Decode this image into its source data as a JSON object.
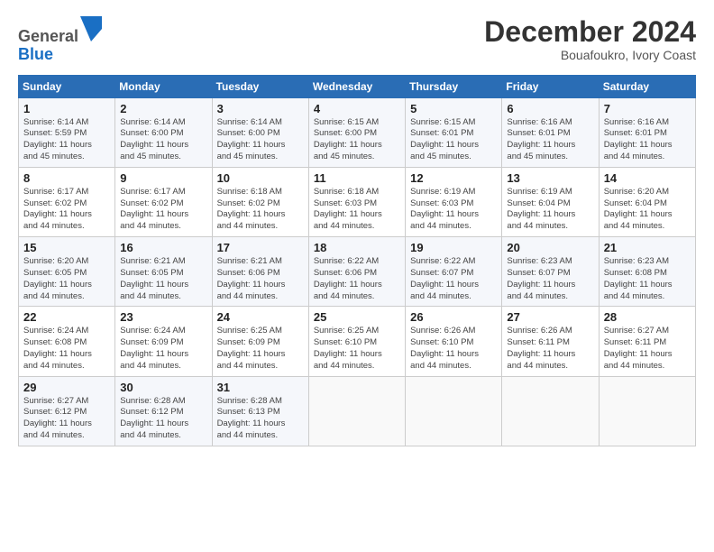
{
  "logo": {
    "general": "General",
    "blue": "Blue"
  },
  "calendar": {
    "title": "December 2024",
    "location": "Bouafoukro, Ivory Coast",
    "days": [
      "Sunday",
      "Monday",
      "Tuesday",
      "Wednesday",
      "Thursday",
      "Friday",
      "Saturday"
    ],
    "weeks": [
      [
        {
          "day": "1",
          "info": "Sunrise: 6:14 AM\nSunset: 5:59 PM\nDaylight: 11 hours\nand 45 minutes."
        },
        {
          "day": "2",
          "info": "Sunrise: 6:14 AM\nSunset: 6:00 PM\nDaylight: 11 hours\nand 45 minutes."
        },
        {
          "day": "3",
          "info": "Sunrise: 6:14 AM\nSunset: 6:00 PM\nDaylight: 11 hours\nand 45 minutes."
        },
        {
          "day": "4",
          "info": "Sunrise: 6:15 AM\nSunset: 6:00 PM\nDaylight: 11 hours\nand 45 minutes."
        },
        {
          "day": "5",
          "info": "Sunrise: 6:15 AM\nSunset: 6:01 PM\nDaylight: 11 hours\nand 45 minutes."
        },
        {
          "day": "6",
          "info": "Sunrise: 6:16 AM\nSunset: 6:01 PM\nDaylight: 11 hours\nand 45 minutes."
        },
        {
          "day": "7",
          "info": "Sunrise: 6:16 AM\nSunset: 6:01 PM\nDaylight: 11 hours\nand 44 minutes."
        }
      ],
      [
        {
          "day": "8",
          "info": "Sunrise: 6:17 AM\nSunset: 6:02 PM\nDaylight: 11 hours\nand 44 minutes."
        },
        {
          "day": "9",
          "info": "Sunrise: 6:17 AM\nSunset: 6:02 PM\nDaylight: 11 hours\nand 44 minutes."
        },
        {
          "day": "10",
          "info": "Sunrise: 6:18 AM\nSunset: 6:02 PM\nDaylight: 11 hours\nand 44 minutes."
        },
        {
          "day": "11",
          "info": "Sunrise: 6:18 AM\nSunset: 6:03 PM\nDaylight: 11 hours\nand 44 minutes."
        },
        {
          "day": "12",
          "info": "Sunrise: 6:19 AM\nSunset: 6:03 PM\nDaylight: 11 hours\nand 44 minutes."
        },
        {
          "day": "13",
          "info": "Sunrise: 6:19 AM\nSunset: 6:04 PM\nDaylight: 11 hours\nand 44 minutes."
        },
        {
          "day": "14",
          "info": "Sunrise: 6:20 AM\nSunset: 6:04 PM\nDaylight: 11 hours\nand 44 minutes."
        }
      ],
      [
        {
          "day": "15",
          "info": "Sunrise: 6:20 AM\nSunset: 6:05 PM\nDaylight: 11 hours\nand 44 minutes."
        },
        {
          "day": "16",
          "info": "Sunrise: 6:21 AM\nSunset: 6:05 PM\nDaylight: 11 hours\nand 44 minutes."
        },
        {
          "day": "17",
          "info": "Sunrise: 6:21 AM\nSunset: 6:06 PM\nDaylight: 11 hours\nand 44 minutes."
        },
        {
          "day": "18",
          "info": "Sunrise: 6:22 AM\nSunset: 6:06 PM\nDaylight: 11 hours\nand 44 minutes."
        },
        {
          "day": "19",
          "info": "Sunrise: 6:22 AM\nSunset: 6:07 PM\nDaylight: 11 hours\nand 44 minutes."
        },
        {
          "day": "20",
          "info": "Sunrise: 6:23 AM\nSunset: 6:07 PM\nDaylight: 11 hours\nand 44 minutes."
        },
        {
          "day": "21",
          "info": "Sunrise: 6:23 AM\nSunset: 6:08 PM\nDaylight: 11 hours\nand 44 minutes."
        }
      ],
      [
        {
          "day": "22",
          "info": "Sunrise: 6:24 AM\nSunset: 6:08 PM\nDaylight: 11 hours\nand 44 minutes."
        },
        {
          "day": "23",
          "info": "Sunrise: 6:24 AM\nSunset: 6:09 PM\nDaylight: 11 hours\nand 44 minutes."
        },
        {
          "day": "24",
          "info": "Sunrise: 6:25 AM\nSunset: 6:09 PM\nDaylight: 11 hours\nand 44 minutes."
        },
        {
          "day": "25",
          "info": "Sunrise: 6:25 AM\nSunset: 6:10 PM\nDaylight: 11 hours\nand 44 minutes."
        },
        {
          "day": "26",
          "info": "Sunrise: 6:26 AM\nSunset: 6:10 PM\nDaylight: 11 hours\nand 44 minutes."
        },
        {
          "day": "27",
          "info": "Sunrise: 6:26 AM\nSunset: 6:11 PM\nDaylight: 11 hours\nand 44 minutes."
        },
        {
          "day": "28",
          "info": "Sunrise: 6:27 AM\nSunset: 6:11 PM\nDaylight: 11 hours\nand 44 minutes."
        }
      ],
      [
        {
          "day": "29",
          "info": "Sunrise: 6:27 AM\nSunset: 6:12 PM\nDaylight: 11 hours\nand 44 minutes."
        },
        {
          "day": "30",
          "info": "Sunrise: 6:28 AM\nSunset: 6:12 PM\nDaylight: 11 hours\nand 44 minutes."
        },
        {
          "day": "31",
          "info": "Sunrise: 6:28 AM\nSunset: 6:13 PM\nDaylight: 11 hours\nand 44 minutes."
        },
        {
          "day": "",
          "info": ""
        },
        {
          "day": "",
          "info": ""
        },
        {
          "day": "",
          "info": ""
        },
        {
          "day": "",
          "info": ""
        }
      ]
    ]
  }
}
